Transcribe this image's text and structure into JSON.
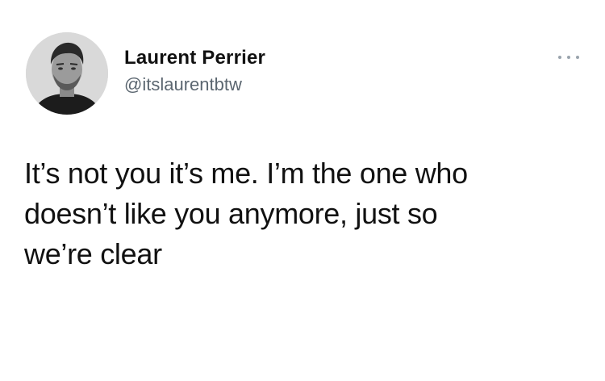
{
  "tweet": {
    "author": {
      "display_name": "Laurent Perrier",
      "handle": "@itslaurentbtw",
      "avatar_icon": "user-avatar-photo"
    },
    "more_icon": "ellipsis-icon",
    "text": "It’s not you it’s me. I’m the one who\ndoesn’t like you anymore, just so\nwe’re clear"
  },
  "colors": {
    "background": "#ffffff",
    "text": "#111111",
    "handle": "#5b6670",
    "more_dots": "#9aa4ad"
  }
}
